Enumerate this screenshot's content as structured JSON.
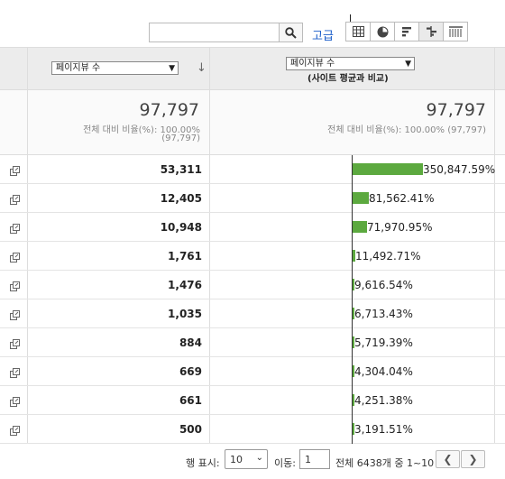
{
  "toolbar": {
    "search_value": "",
    "advanced_label": "고급",
    "view_buttons": [
      "table-view",
      "pie-view",
      "bar-view",
      "comparison-view",
      "pivot-view"
    ],
    "active_view": "comparison-view"
  },
  "header": {
    "metric_select": "페이지뷰 수",
    "compare_select": "페이지뷰 수",
    "compare_label": "(사이트 평균과 비교)"
  },
  "summary": {
    "left_total": "97,797",
    "left_line1": "전체 대비 비율(%): 100.00%",
    "left_line2": "(97,797)",
    "right_total": "97,797",
    "right_line1": "전체 대비 비율(%): 100.00% (97,797)"
  },
  "rows": [
    {
      "value": "53,311",
      "pct": "350,847.59%",
      "bar_fraction": 1.0
    },
    {
      "value": "12,405",
      "pct": "81,562.41%",
      "bar_fraction": 0.232
    },
    {
      "value": "10,948",
      "pct": "71,970.95%",
      "bar_fraction": 0.205
    },
    {
      "value": "1,761",
      "pct": "11,492.71%",
      "bar_fraction": 0.033
    },
    {
      "value": "1,476",
      "pct": "9,616.54%",
      "bar_fraction": 0.027
    },
    {
      "value": "1,035",
      "pct": "6,713.43%",
      "bar_fraction": 0.019
    },
    {
      "value": "884",
      "pct": "5,719.39%",
      "bar_fraction": 0.016
    },
    {
      "value": "669",
      "pct": "4,304.04%",
      "bar_fraction": 0.012
    },
    {
      "value": "661",
      "pct": "4,251.38%",
      "bar_fraction": 0.012
    },
    {
      "value": "500",
      "pct": "3,191.51%",
      "bar_fraction": 0.009
    }
  ],
  "colors": {
    "bar": "#5ca93f",
    "link": "#1a5dc9"
  },
  "footer": {
    "rows_label": "행 표시:",
    "rows_value": "10",
    "goto_label": "이동:",
    "goto_value": "1",
    "range_text": "전체 6438개 중 1~10",
    "prev": "❮",
    "next": "❯"
  }
}
